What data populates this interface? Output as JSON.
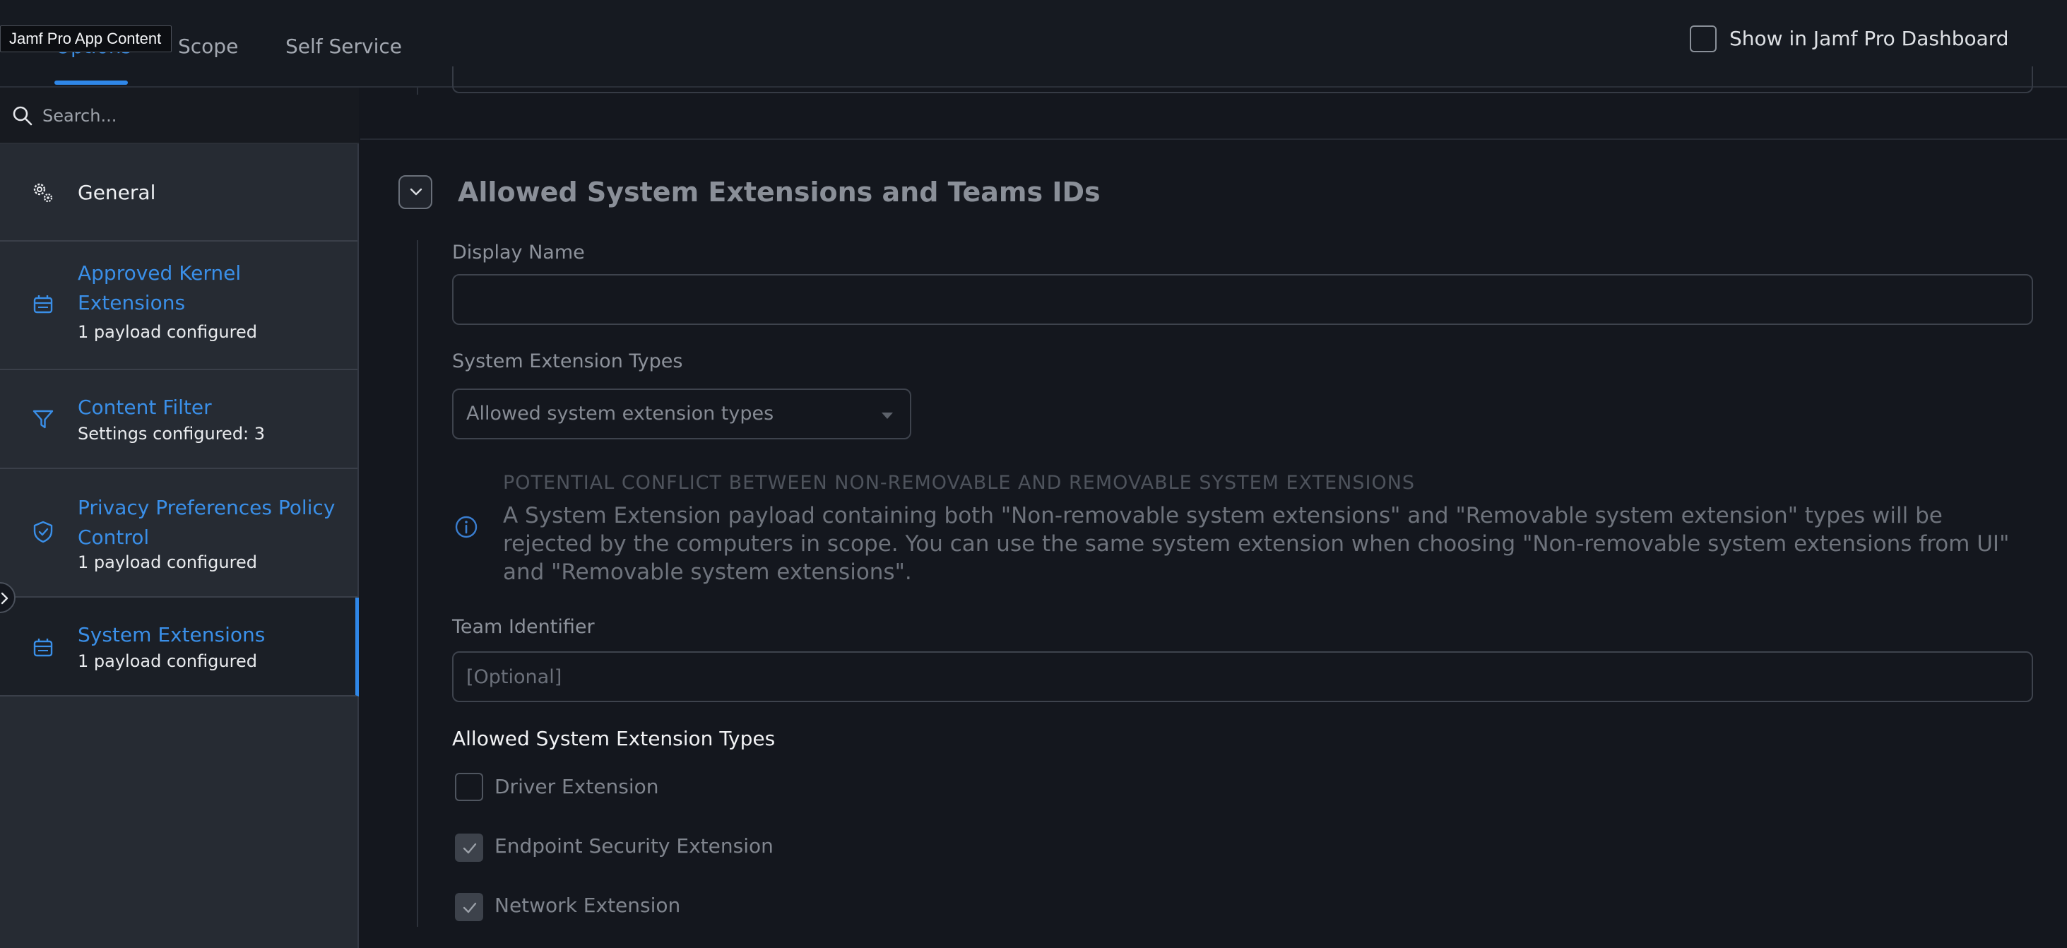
{
  "tabs": {
    "options": "Options",
    "scope": "Scope",
    "self_service": "Self Service"
  },
  "tooltip": "Jamf Pro App Content",
  "dashboard": {
    "checkbox_label": "Show in Jamf Pro Dashboard",
    "checked": false
  },
  "sidebar": {
    "search_placeholder": "Search...",
    "items": [
      {
        "title": "General",
        "subtitle": "",
        "icon": "gear-icon"
      },
      {
        "title": "Approved Kernel Extensions",
        "subtitle": "1 payload configured",
        "icon": "extension-icon"
      },
      {
        "title": "Content Filter",
        "subtitle": "Settings configured: 3",
        "icon": "filter-icon"
      },
      {
        "title": "Privacy Preferences Policy Control",
        "subtitle": "1 payload configured",
        "icon": "shield-icon"
      },
      {
        "title": "System Extensions",
        "subtitle": "1 payload configured",
        "icon": "extension-icon",
        "active": true
      }
    ]
  },
  "section": {
    "title": "Allowed System Extensions and Teams IDs",
    "display_name_label": "Display Name",
    "display_name_value": "",
    "types_label": "System Extension Types",
    "types_value": "Allowed system extension types",
    "warning_title": "POTENTIAL CONFLICT BETWEEN NON-REMOVABLE AND REMOVABLE SYSTEM EXTENSIONS",
    "warning_body": "A System Extension payload containing both \"Non-removable system extensions\" and \"Removable system extension\" types will be rejected by the computers in scope. You can use the same system extension when choosing \"Non-removable system extensions from UI\" and \"Removable system extensions\".",
    "team_id_label": "Team Identifier",
    "team_id_placeholder": "[Optional]",
    "allowed_types_heading": "Allowed System Extension Types",
    "allowed_types": [
      {
        "label": "Driver Extension",
        "checked": false
      },
      {
        "label": "Endpoint Security Extension",
        "checked": true
      },
      {
        "label": "Network Extension",
        "checked": true
      }
    ]
  },
  "colors": {
    "accent": "#2f87e8",
    "background": "#14171e",
    "sidebar": "#262b33"
  }
}
